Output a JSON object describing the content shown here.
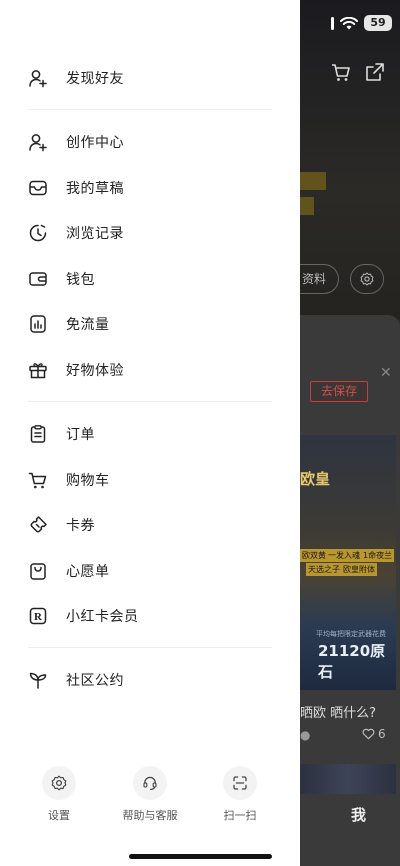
{
  "status_bar": {
    "battery": "59"
  },
  "drawer": {
    "groups": [
      {
        "items": [
          {
            "label": "发现好友",
            "icon": "add-user-icon"
          }
        ]
      },
      {
        "items": [
          {
            "label": "创作中心",
            "icon": "creator-icon"
          },
          {
            "label": "我的草稿",
            "icon": "drafts-tray-icon"
          },
          {
            "label": "浏览记录",
            "icon": "history-clock-icon"
          },
          {
            "label": "钱包",
            "icon": "wallet-icon"
          },
          {
            "label": "免流量",
            "icon": "data-bars-icon"
          },
          {
            "label": "好物体验",
            "icon": "gift-icon"
          }
        ]
      },
      {
        "items": [
          {
            "label": "订单",
            "icon": "clipboard-icon"
          },
          {
            "label": "购物车",
            "icon": "cart-icon"
          },
          {
            "label": "卡券",
            "icon": "coupon-ticket-icon"
          },
          {
            "label": "心愿单",
            "icon": "wishlist-bag-icon"
          },
          {
            "label": "小红卡会员",
            "icon": "membership-r-icon"
          }
        ]
      },
      {
        "items": [
          {
            "label": "社区公约",
            "icon": "sprout-icon"
          }
        ]
      }
    ],
    "bottom_actions": [
      {
        "label": "设置",
        "icon": "gear-icon"
      },
      {
        "label": "帮助与客服",
        "icon": "headset-icon"
      },
      {
        "label": "扫一扫",
        "icon": "scan-icon"
      }
    ]
  },
  "background": {
    "profile_edit_partial": "资料",
    "save_button": "去保存",
    "poster_text_1": "欧皇",
    "poster_tags": [
      "一发入魂",
      "1命夜兰",
      "欧双黄",
      "天选之子",
      "欧皇附体"
    ],
    "poster_small_text": "平均每把限定武器花费",
    "poster_big_text": "21120原石",
    "note_title_partial": "晒欧 晒什么?",
    "note_like_count": "6",
    "tab_me": "我"
  }
}
